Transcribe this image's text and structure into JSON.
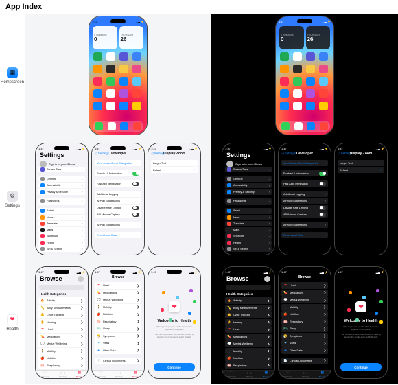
{
  "page_title": "App Index",
  "apps": {
    "homescreen": {
      "label": "Homescreen",
      "icon_color": "#007aff"
    },
    "settings": {
      "label": "Settings",
      "icon_color": "#8e8e93"
    },
    "health": {
      "label": "Health",
      "icon_color": "#ff2d55"
    }
  },
  "status": {
    "time": "1:47",
    "battery": "●●●"
  },
  "home": {
    "widget1": {
      "line1": "0 Invitations",
      "line2": "0"
    },
    "widget2": {
      "line1": "THURSDAY",
      "line2": "26"
    },
    "app_colors": [
      "#1fa955",
      "#fff",
      "#5856d6",
      "#3b82f6",
      "#ff9500",
      "#2b2b2b",
      "#f7c945",
      "#ea4c89",
      "#ff2d55",
      "#34c759",
      "#0a84ff",
      "#5ac8fa",
      "#0a84ff",
      "#fff",
      "#af52de",
      "#ff453a",
      "#0a84ff",
      "#fff",
      "#0a84ff",
      "#ffcc00"
    ],
    "dock_colors": [
      "#30d158",
      "#fff",
      "#0a84ff",
      "#ff453a"
    ]
  },
  "settings": {
    "main": {
      "title": "Settings",
      "profile_name": "Sign in to your iPhone",
      "items": [
        {
          "icon": "#5856d6",
          "label": "Screen Time"
        },
        {
          "gap": true
        },
        {
          "icon": "#8e8e93",
          "label": "General"
        },
        {
          "icon": "#0a84ff",
          "label": "Accessibility"
        },
        {
          "icon": "#0a84ff",
          "label": "Privacy & Security"
        },
        {
          "gap": true
        },
        {
          "icon": "#8e8e93",
          "label": "Passwords"
        },
        {
          "gap": true
        },
        {
          "icon": "#0a84ff",
          "label": "Safari"
        },
        {
          "icon": "#ff9500",
          "label": "News"
        },
        {
          "icon": "#ff453a",
          "label": "Translate"
        },
        {
          "icon": "#1c1c1e",
          "label": "Maps"
        },
        {
          "icon": "#ff2d55",
          "label": "Shortcuts"
        },
        {
          "icon": "#ff2d55",
          "label": "Health"
        },
        {
          "icon": "#8e8e93",
          "label": "Siri & Search"
        }
      ]
    },
    "developer": {
      "back": "◁ Settings",
      "title": "Developer",
      "items": [
        {
          "label": "View JetsamEvent Categories",
          "link": true
        },
        {
          "gap": true
        },
        {
          "label": "Enable UI Automation",
          "toggle": "on"
        },
        {
          "gap": true
        },
        {
          "label": "Fast App Termination",
          "toggle": "off"
        },
        {
          "gap": true
        },
        {
          "label": "Additional Logging",
          "chev": true
        },
        {
          "label": "AirPlay Suggestions",
          "chev": true
        },
        {
          "label": "Disable Rate Limiting",
          "toggle": "off"
        },
        {
          "label": "API Misuse Capture",
          "toggle": "off"
        },
        {
          "gap": true
        },
        {
          "label": "AirPlay Suggestions",
          "chev": true
        },
        {
          "gap": true
        },
        {
          "label": "Reset Local Data",
          "link": true
        }
      ]
    },
    "zoom": {
      "back": "◁ Settings",
      "title": "Display Zoom",
      "items": [
        {
          "label": "Larger Text"
        },
        {
          "label": "Default",
          "check": true
        }
      ]
    }
  },
  "health": {
    "browse": {
      "title": "Browse",
      "section": "Health Categories",
      "cats": [
        {
          "icon": "🔥",
          "label": "Activity",
          "c": "#ff9500"
        },
        {
          "icon": "📏",
          "label": "Body Measurements",
          "c": "#af52de"
        },
        {
          "icon": "👶",
          "label": "Cycle Tracking",
          "c": "#ff2d55"
        },
        {
          "icon": "👂",
          "label": "Hearing",
          "c": "#0a84ff"
        },
        {
          "icon": "❤",
          "label": "Heart",
          "c": "#ff3b30"
        },
        {
          "icon": "💊",
          "label": "Medications",
          "c": "#5ac8fa"
        },
        {
          "icon": "💭",
          "label": "Mental Wellbeing",
          "c": "#64d2a2"
        },
        {
          "icon": "🚶",
          "label": "Mobility",
          "c": "#ff9500"
        },
        {
          "icon": "🍎",
          "label": "Nutrition",
          "c": "#30d158"
        },
        {
          "icon": "🫁",
          "label": "Respiratory",
          "c": "#5ac8fa"
        }
      ],
      "tabs": [
        {
          "icon": "♡",
          "label": "Summary"
        },
        {
          "icon": "⋮⋮",
          "label": "Sharing"
        },
        {
          "icon": "▦",
          "label": "Browse"
        }
      ]
    },
    "browse2_extra": [
      {
        "icon": "❤",
        "label": "Heart",
        "c": "#ff3b30"
      },
      {
        "icon": "💊",
        "label": "Medications",
        "c": "#5ac8fa"
      },
      {
        "icon": "💭",
        "label": "Mental Wellbeing",
        "c": "#64d2a2"
      },
      {
        "icon": "🚶",
        "label": "Mobility",
        "c": "#ff9500"
      },
      {
        "icon": "🍎",
        "label": "Nutrition",
        "c": "#30d158"
      },
      {
        "icon": "🫁",
        "label": "Respiratory",
        "c": "#5ac8fa"
      },
      {
        "icon": "🛏",
        "label": "Sleep",
        "c": "#64d2a2"
      },
      {
        "icon": "🤧",
        "label": "Symptoms",
        "c": "#af52de"
      },
      {
        "icon": "❤",
        "label": "Vitals",
        "c": "#5ac8fa"
      },
      {
        "icon": "✚",
        "label": "Other Data",
        "c": "#0a84ff"
      },
      {
        "gap": true
      },
      {
        "icon": "📄",
        "label": "Clinical Documents",
        "c": "#0a84ff"
      }
    ],
    "welcome": {
      "title": "Welcome to Health",
      "desc": "This app keeps your health information together in one place.",
      "note": "You can add photos, documents, or data by tapping the profile and Health Details.",
      "btn": "Continue",
      "dot_colors": [
        "#ff9500",
        "#af52de",
        "#5ac8fa",
        "#30d158",
        "#ff2d55",
        "#0a84ff",
        "#64d2a2",
        "#ffcc00"
      ]
    }
  }
}
